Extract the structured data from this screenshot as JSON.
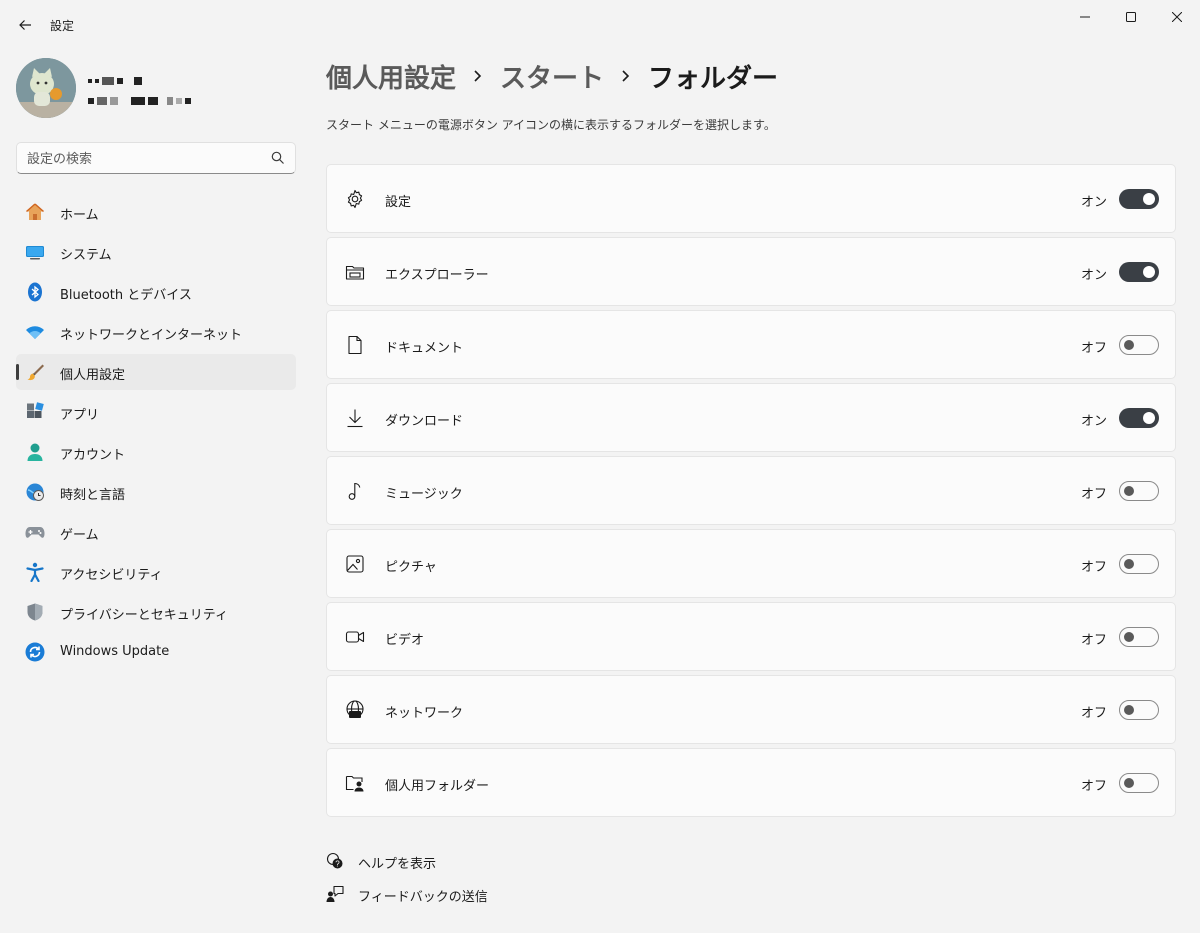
{
  "window": {
    "title": "設定"
  },
  "profile": {
    "name_redacted": true,
    "email_redacted": true
  },
  "search": {
    "placeholder": "設定の検索"
  },
  "sidebar": {
    "items": [
      {
        "label": "ホーム",
        "icon": "home-icon"
      },
      {
        "label": "システム",
        "icon": "system-icon"
      },
      {
        "label": "Bluetooth とデバイス",
        "icon": "bluetooth-icon"
      },
      {
        "label": "ネットワークとインターネット",
        "icon": "wifi-icon"
      },
      {
        "label": "個人用設定",
        "icon": "brush-icon",
        "active": true
      },
      {
        "label": "アプリ",
        "icon": "apps-icon"
      },
      {
        "label": "アカウント",
        "icon": "account-icon"
      },
      {
        "label": "時刻と言語",
        "icon": "time-language-icon"
      },
      {
        "label": "ゲーム",
        "icon": "gamepad-icon"
      },
      {
        "label": "アクセシビリティ",
        "icon": "accessibility-icon"
      },
      {
        "label": "プライバシーとセキュリティ",
        "icon": "shield-icon"
      },
      {
        "label": "Windows Update",
        "icon": "windows-update-icon"
      }
    ]
  },
  "breadcrumb": {
    "items": [
      "個人用設定",
      "スタート",
      "フォルダー"
    ]
  },
  "description": "スタート メニューの電源ボタン アイコンの横に表示するフォルダーを選択します。",
  "folders": {
    "items": [
      {
        "label": "設定",
        "state": "オン",
        "on": true,
        "icon": "gear-icon"
      },
      {
        "label": "エクスプローラー",
        "state": "オン",
        "on": true,
        "icon": "file-explorer-icon"
      },
      {
        "label": "ドキュメント",
        "state": "オフ",
        "on": false,
        "icon": "document-icon"
      },
      {
        "label": "ダウンロード",
        "state": "オン",
        "on": true,
        "icon": "download-icon"
      },
      {
        "label": "ミュージック",
        "state": "オフ",
        "on": false,
        "icon": "music-icon"
      },
      {
        "label": "ピクチャ",
        "state": "オフ",
        "on": false,
        "icon": "picture-icon"
      },
      {
        "label": "ビデオ",
        "state": "オフ",
        "on": false,
        "icon": "video-icon"
      },
      {
        "label": "ネットワーク",
        "state": "オフ",
        "on": false,
        "icon": "network-icon"
      },
      {
        "label": "個人用フォルダー",
        "state": "オフ",
        "on": false,
        "icon": "personal-folder-icon"
      }
    ]
  },
  "links": {
    "help": "ヘルプを表示",
    "feedback": "フィードバックの送信"
  },
  "colors": {
    "background": "#f3f3f3",
    "card": "#fbfbfb",
    "toggle_on": "#3a3f45",
    "active_nav": "#eaeaea"
  }
}
